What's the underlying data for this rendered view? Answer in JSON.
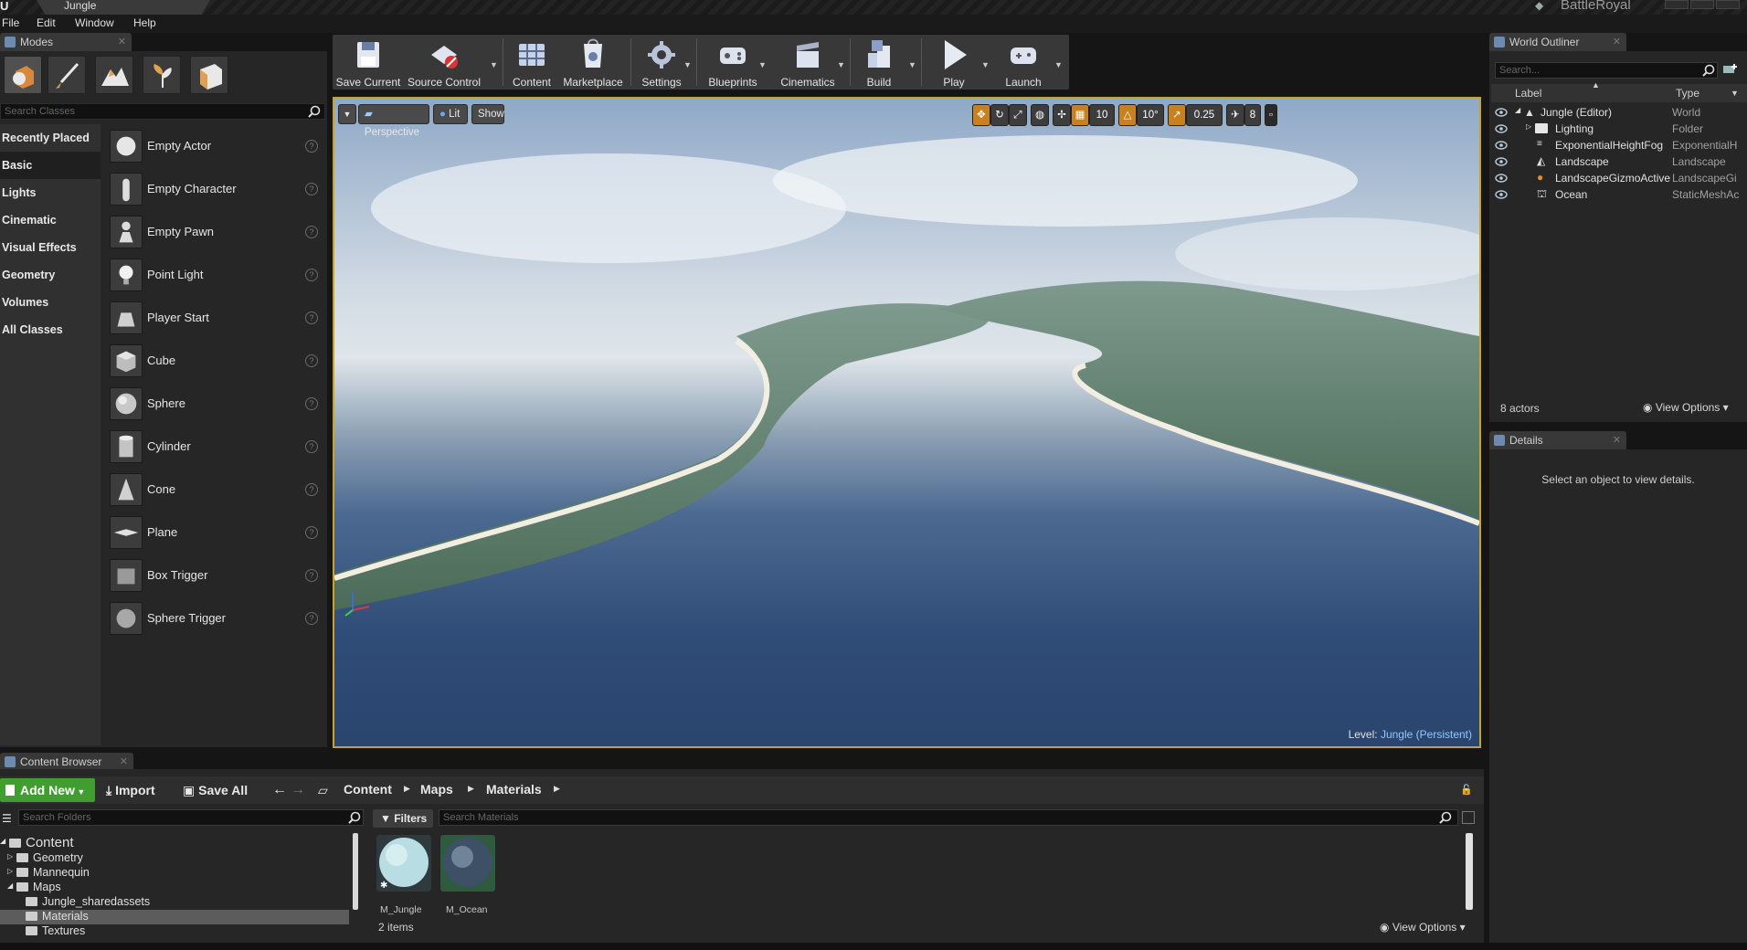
{
  "window": {
    "doc_tab": "Jungle",
    "project": "BattleRoyal"
  },
  "menu": [
    "File",
    "Edit",
    "Window",
    "Help"
  ],
  "modes": {
    "tab_label": "Modes",
    "search_placeholder": "Search Classes",
    "categories": [
      "Recently Placed",
      "Basic",
      "Lights",
      "Cinematic",
      "Visual Effects",
      "Geometry",
      "Volumes",
      "All Classes"
    ],
    "items": [
      "Empty Actor",
      "Empty Character",
      "Empty Pawn",
      "Point Light",
      "Player Start",
      "Cube",
      "Sphere",
      "Cylinder",
      "Cone",
      "Plane",
      "Box Trigger",
      "Sphere Trigger"
    ]
  },
  "toolbar": {
    "save": "Save Current",
    "source_control": "Source Control",
    "content": "Content",
    "marketplace": "Marketplace",
    "settings": "Settings",
    "blueprints": "Blueprints",
    "cinematics": "Cinematics",
    "build": "Build",
    "play": "Play",
    "launch": "Launch"
  },
  "viewport": {
    "perspective": "Perspective",
    "lit": "Lit",
    "show": "Show",
    "grid_snap": "10",
    "rotation_snap": "10°",
    "scale_snap": "0.25",
    "camera_speed": "8",
    "level_label": "Level:",
    "level_name": "Jungle (Persistent)"
  },
  "outliner": {
    "tab_label": "World Outliner",
    "search_placeholder": "Search...",
    "col_label": "Label",
    "col_type": "Type",
    "rows": [
      {
        "label": "Jungle (Editor)",
        "type": "World"
      },
      {
        "label": "Lighting",
        "type": "Folder"
      },
      {
        "label": "ExponentialHeightFog",
        "type": "ExponentialH"
      },
      {
        "label": "Landscape",
        "type": "Landscape"
      },
      {
        "label": "LandscapeGizmoActive",
        "type": "LandscapeGi"
      },
      {
        "label": "Ocean",
        "type": "StaticMeshAc"
      }
    ],
    "count": "8 actors",
    "view_options": "View Options"
  },
  "details": {
    "tab_label": "Details",
    "empty_message": "Select an object to view details."
  },
  "content_browser": {
    "tab_label": "Content Browser",
    "add_new": "Add New",
    "import": "Import",
    "save_all": "Save All",
    "breadcrumb": [
      "Content",
      "Maps",
      "Materials"
    ],
    "folders_placeholder": "Search Folders",
    "filters": "Filters",
    "search_placeholder": "Search Materials",
    "folders": [
      {
        "name": "Content",
        "indent": 0
      },
      {
        "name": "Geometry",
        "indent": 1
      },
      {
        "name": "Mannequin",
        "indent": 1
      },
      {
        "name": "Maps",
        "indent": 1
      },
      {
        "name": "Jungle_sharedassets",
        "indent": 2
      },
      {
        "name": "Materials",
        "indent": 2
      },
      {
        "name": "Textures",
        "indent": 2
      }
    ],
    "assets": [
      "M_Jungle",
      "M_Ocean"
    ],
    "count": "2 items",
    "view_options": "View Options"
  },
  "colors": {
    "accent": "#c9a227",
    "add_new": "#3f9e2f",
    "level_name": "#8fc8ff"
  }
}
